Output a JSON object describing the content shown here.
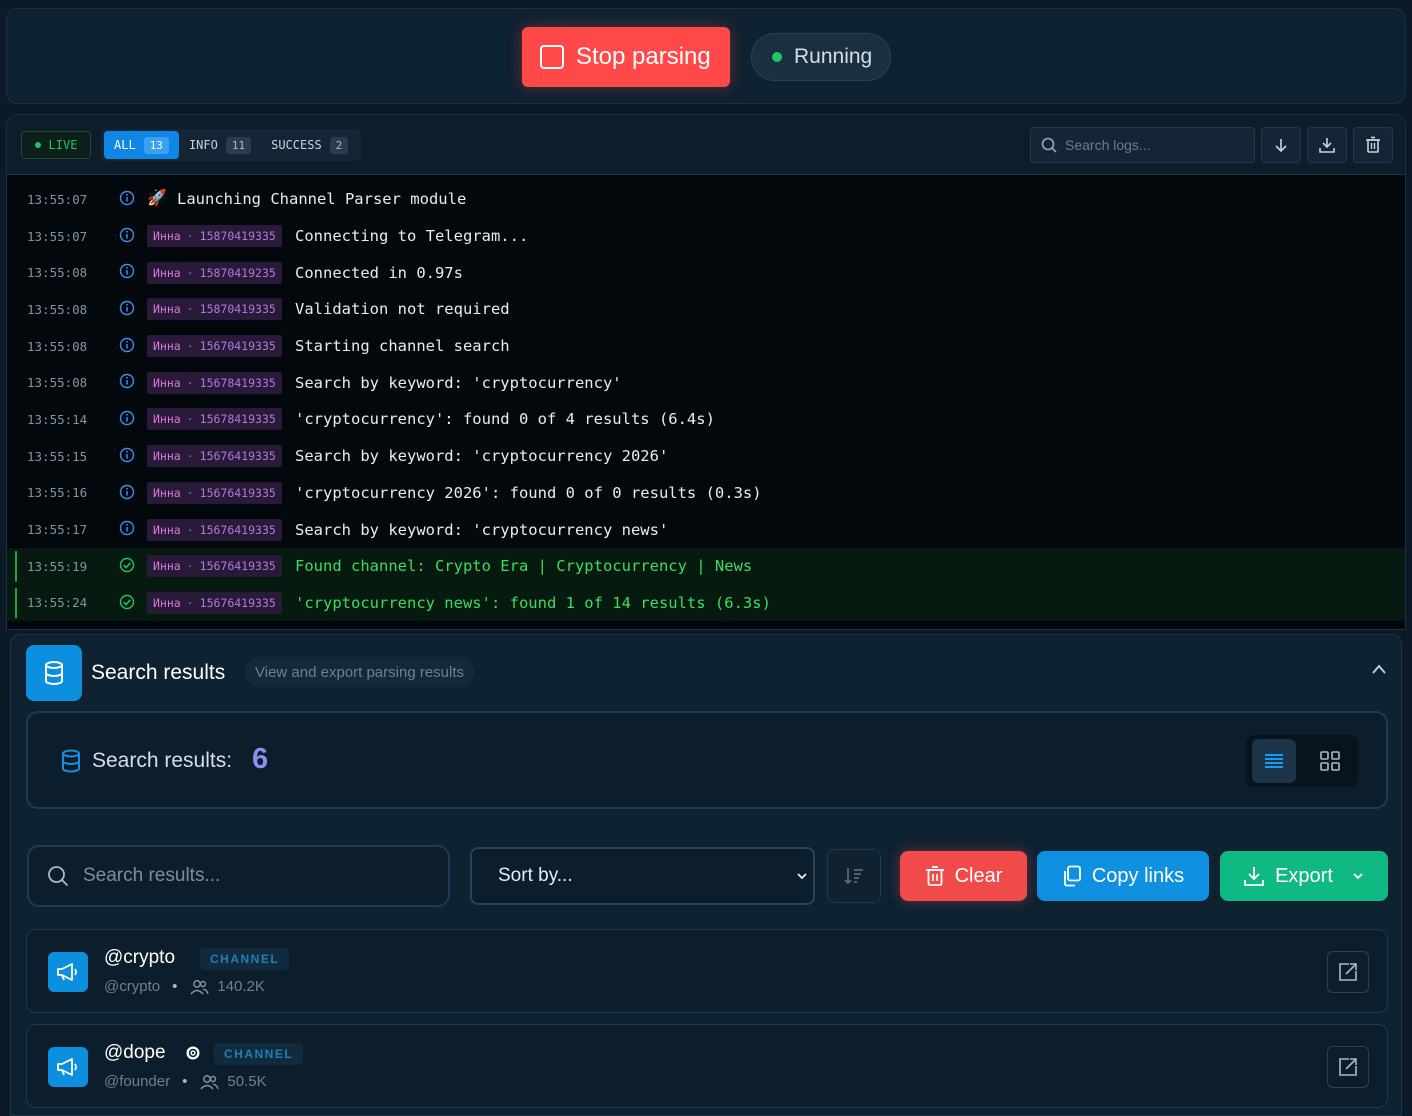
{
  "controls": {
    "stop_label": "Stop parsing",
    "status_label": "Running"
  },
  "log": {
    "live_label": "LIVE",
    "filters": [
      {
        "label": "ALL",
        "count": "13"
      },
      {
        "label": "INFO",
        "count": "11"
      },
      {
        "label": "SUCCESS",
        "count": "2"
      }
    ],
    "search_placeholder": "Search logs...",
    "first_message": "Launching Channel Parser module",
    "first_time": "13:55:07",
    "rows": [
      {
        "time": "13:55:07",
        "name": "Инна",
        "id": "15870419335",
        "message": "Connecting to Telegram...",
        "level": "info"
      },
      {
        "time": "13:55:08",
        "name": "Инна",
        "id": "15870419235",
        "message": "Connected in 0.97s",
        "level": "info"
      },
      {
        "time": "13:55:08",
        "name": "Инна",
        "id": "15870419335",
        "message": "Validation not required",
        "level": "info"
      },
      {
        "time": "13:55:08",
        "name": "Инна",
        "id": "15670419335",
        "message": "Starting channel search",
        "level": "info"
      },
      {
        "time": "13:55:08",
        "name": "Инна",
        "id": "15678419335",
        "message": "Search by keyword: 'cryptocurrency'",
        "level": "info"
      },
      {
        "time": "13:55:14",
        "name": "Инна",
        "id": "15678419335",
        "message": "'cryptocurrency': found 0 of 4 results (6.4s)",
        "level": "info"
      },
      {
        "time": "13:55:15",
        "name": "Инна",
        "id": "15676419335",
        "message": "Search by keyword: 'cryptocurrency 2026'",
        "level": "info"
      },
      {
        "time": "13:55:16",
        "name": "Инна",
        "id": "15676419335",
        "message": "'cryptocurrency 2026': found 0 of 0 results (0.3s)",
        "level": "info"
      },
      {
        "time": "13:55:17",
        "name": "Инна",
        "id": "15676419335",
        "message": "Search by keyword: 'cryptocurrency news'",
        "level": "info"
      },
      {
        "time": "13:55:19",
        "name": "Инна",
        "id": "15676419335",
        "message": "Found channel: Crypto Era | Cryptocurrency | News",
        "level": "success"
      },
      {
        "time": "13:55:24",
        "name": "Инна",
        "id": "15676419335",
        "message": "'cryptocurrency news': found 1 of 14 results (6.3s)",
        "level": "success"
      }
    ]
  },
  "results": {
    "title": "Search results",
    "subtitle": "View and export parsing results",
    "count_label": "Search results:",
    "count": "6",
    "search_placeholder": "Search results...",
    "sort_placeholder": "Sort by...",
    "clear_label": "Clear",
    "copy_label": "Copy links",
    "export_label": "Export",
    "items": [
      {
        "name": "@crypto",
        "badge": "CHANNEL",
        "username": "@crypto",
        "subscribers": "140.2K",
        "verified": false
      },
      {
        "name": "@dope",
        "badge": "CHANNEL",
        "username": "@founder",
        "subscribers": "50.5K",
        "verified": true
      }
    ]
  },
  "colors": {
    "accent": "#0f90e0",
    "danger": "#ff4848",
    "success": "#10b981",
    "log_success_text": "#3ddc5f"
  }
}
